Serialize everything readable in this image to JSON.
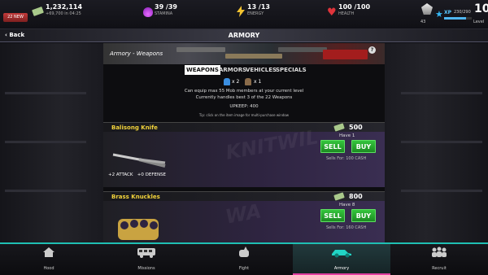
{
  "stats": {
    "new_badge": "22 NEW",
    "cash": "1,232,114",
    "cash_rate": "+69,700 in 04:25",
    "stamina": "39 /39",
    "stamina_label": "STAMINA",
    "energy": "13 /13",
    "energy_label": "ENERGY",
    "health": "100 /100",
    "health_label": "HEALTH",
    "rank_count": "43",
    "xp_label": "XP",
    "xp_value": "230/290",
    "xp_fraction": 0.79,
    "level": "10",
    "level_label": "Level"
  },
  "titlebar": {
    "back_label": "Back",
    "title": "ARMORY"
  },
  "banner": {
    "title": "Armory - Weapons",
    "help": "?"
  },
  "tabs": [
    {
      "label": "WEAPONS",
      "active": true
    },
    {
      "label": "ARMORS",
      "active": false
    },
    {
      "label": "VEHICLES",
      "active": false
    },
    {
      "label": "SPECIALS",
      "active": false
    }
  ],
  "info": {
    "multiplier_a": "x 2",
    "multiplier_b": "x 1",
    "line1": "Can equip max 55 Mob members at your current level",
    "line2": "Currently handles best 3 of the 22 Weapons",
    "upkeep": "UPKEEP: 400",
    "tip": "Tip: click on the item image for multi-purchase window"
  },
  "items": [
    {
      "name": "Balisong Knife",
      "price": "500",
      "have": "Have 1",
      "sell_label": "SELL",
      "buy_label": "BUY",
      "sells_for": "Sells For: 100 CASH",
      "attack": "+2 ATTACK",
      "defense": "+0 DEFENSE"
    },
    {
      "name": "Brass Knuckles",
      "price": "800",
      "have": "Have 8",
      "sell_label": "SELL",
      "buy_label": "BUY",
      "sells_for": "Sells For: 160 CASH"
    }
  ],
  "nav": [
    {
      "label": "Hood",
      "icon": "house-icon",
      "active": false
    },
    {
      "label": "Missions",
      "icon": "bus-icon",
      "active": false
    },
    {
      "label": "Fight",
      "icon": "fist-icon",
      "active": false
    },
    {
      "label": "Armory",
      "icon": "car-icon",
      "active": true
    },
    {
      "label": "Recruit",
      "icon": "crowd-icon",
      "active": false
    }
  ],
  "colors": {
    "accent_teal": "#1fbfb3",
    "active_pink": "#e23fa0",
    "item_gold": "#f2d33b",
    "button_green": "#2aa830"
  }
}
